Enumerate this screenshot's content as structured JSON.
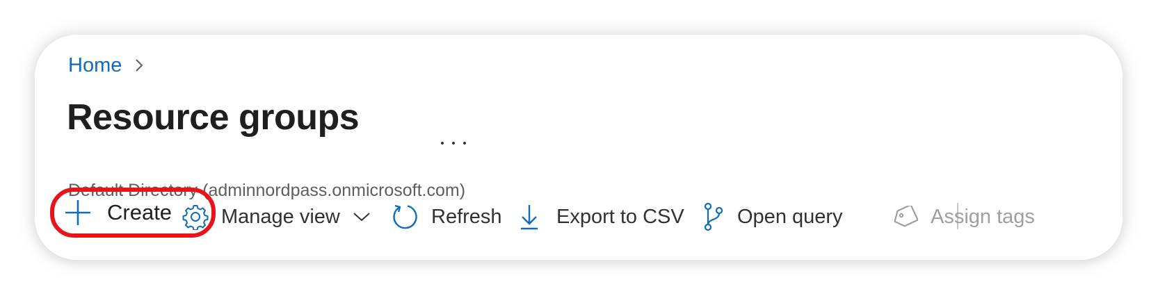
{
  "breadcrumb": {
    "home_label": "Home"
  },
  "page": {
    "title": "Resource groups",
    "subtitle": "Default Directory (adminnordpass.onmicrosoft.com)"
  },
  "toolbar": {
    "create_label": "Create",
    "manage_view_label": "Manage view",
    "refresh_label": "Refresh",
    "export_label": "Export to CSV",
    "open_query_label": "Open query",
    "assign_tags_label": "Assign tags"
  },
  "icons": {
    "more": "more-icon",
    "create": "plus-icon",
    "manage_view": "gear-icon",
    "manage_view_dropdown": "chevron-down-icon",
    "refresh": "refresh-icon",
    "export": "download-icon",
    "open_query": "branch-icon",
    "assign_tags": "tag-icon"
  },
  "colors": {
    "accent": "#0f6cbd",
    "highlight": "#e8141a",
    "disabled": "#a19f9d"
  }
}
